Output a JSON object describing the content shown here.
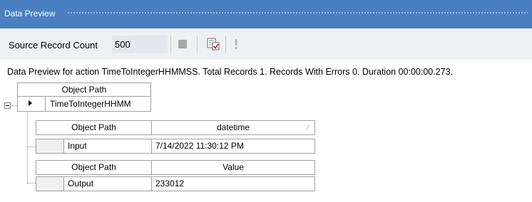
{
  "window": {
    "title": "Data Preview"
  },
  "toolbar": {
    "source_label": "Source Record Count",
    "source_value": "500",
    "stop_icon": "stop-icon",
    "view_icon": "preview-check-icon",
    "alert_icon": "exclamation-icon"
  },
  "status": "Data Preview for action TimeToIntegerHHMMSS. Total Records 1. Records With Errors 0. Duration 00:00:00.273.",
  "parent_grid": {
    "header": "Object Path",
    "row_value": "TimeToIntegerHHMM"
  },
  "input_grid": {
    "headers": [
      "Object Path",
      "datetime"
    ],
    "row": [
      "Input",
      "7/14/2022 11:30:12 PM"
    ]
  },
  "output_grid": {
    "headers": [
      "Object Path",
      "Value"
    ],
    "row": [
      "Output",
      "233012"
    ]
  },
  "colors": {
    "titlebar": "#4a7fc1",
    "toolbar": "#eef0f3"
  }
}
